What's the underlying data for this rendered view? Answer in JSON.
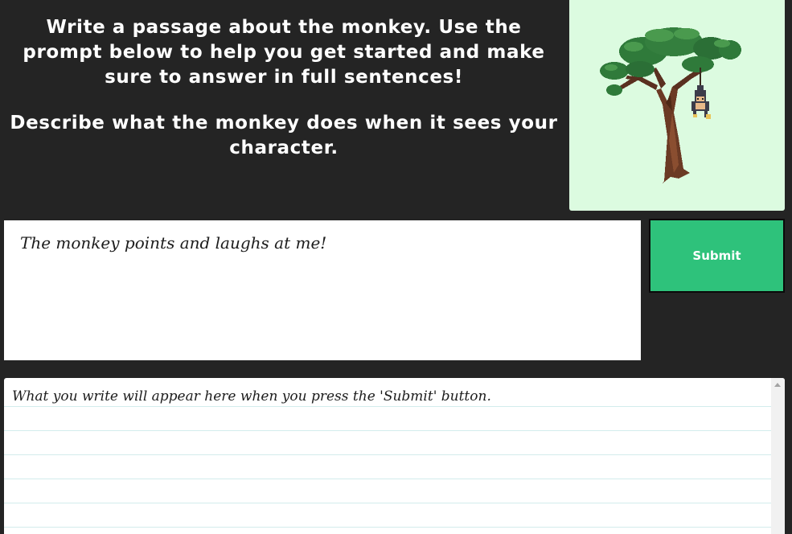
{
  "prompt": {
    "instruction": "Write a passage about the monkey. Use the prompt below to help you get started and make sure to answer in full sentences!",
    "question": "Describe what the monkey does when it sees your character."
  },
  "image": {
    "subject": "tree-with-hanging-monkey",
    "background_color": "#dcfbe0"
  },
  "editor": {
    "value": "The monkey points and laughs at me!"
  },
  "submit": {
    "label": "Submit",
    "color": "#2ec27b"
  },
  "output": {
    "placeholder_text": "What you write will appear here when you press the 'Submit' button."
  }
}
